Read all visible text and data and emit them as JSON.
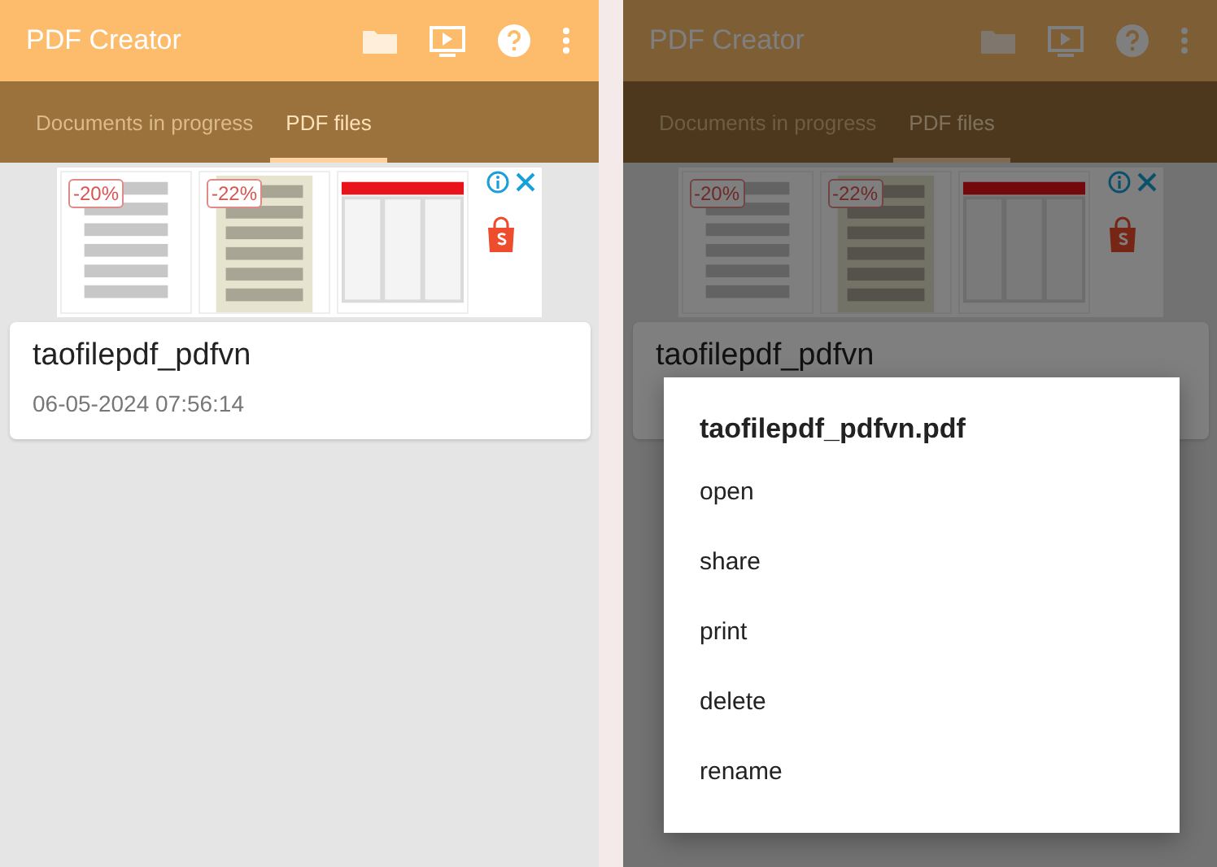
{
  "panels": [
    {
      "dimmed": false,
      "app_bar": {
        "title": "PDF Creator"
      },
      "tabs": [
        {
          "label": "Documents in progress",
          "selected": false
        },
        {
          "label": "PDF files",
          "selected": true
        }
      ],
      "ad": {
        "tiles": [
          {
            "kind": "text-page",
            "badge": "-20%"
          },
          {
            "kind": "photo-page",
            "badge": "-22%"
          },
          {
            "kind": "table-page"
          }
        ]
      },
      "files": [
        {
          "name": "taofilepdf_pdfvn",
          "date": "06-05-2024 07:56:14"
        }
      ]
    },
    {
      "dimmed": true,
      "app_bar": {
        "title": "PDF Creator"
      },
      "tabs": [
        {
          "label": "Documents in progress",
          "selected": false
        },
        {
          "label": "PDF files",
          "selected": true
        }
      ],
      "ad": {
        "tiles": [
          {
            "kind": "text-page",
            "badge": "-20%"
          },
          {
            "kind": "photo-page",
            "badge": "-22%"
          },
          {
            "kind": "table-page"
          }
        ]
      },
      "files": [
        {
          "name": "taofilepdf_pdfvn"
        }
      ],
      "dialog": {
        "title": "taofilepdf_pdfvn.pdf",
        "items": [
          "open",
          "share",
          "print",
          "delete",
          "rename"
        ]
      }
    }
  ]
}
